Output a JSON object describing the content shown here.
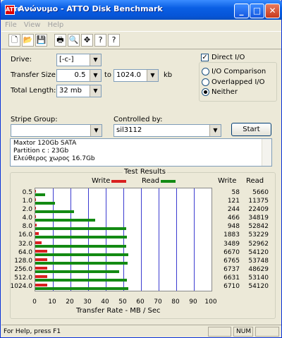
{
  "window": {
    "title": "Ανώνυμο - ATTO Disk Benchmark",
    "app_icon": "ATTO",
    "min": "_",
    "max": "□",
    "close": "✕"
  },
  "menu": [
    "File",
    "View",
    "Help"
  ],
  "toolbar": [
    {
      "icon": "new-icon",
      "glyph": "🗋"
    },
    {
      "icon": "open-icon",
      "glyph": "📂"
    },
    {
      "icon": "save-icon",
      "glyph": "💾"
    },
    {
      "icon": "print-icon",
      "glyph": "🖶"
    },
    {
      "icon": "print-preview-icon",
      "glyph": "🔍"
    },
    {
      "icon": "move-icon",
      "glyph": "✥"
    },
    {
      "icon": "help-icon",
      "glyph": "?"
    },
    {
      "icon": "context-help-icon",
      "glyph": "?"
    }
  ],
  "form": {
    "drive_label": "Drive:",
    "drive_value": "[-c-]",
    "transfer_label": "Transfer Size:",
    "transfer_from": "0.5",
    "to_label": "to",
    "transfer_to": "1024.0",
    "kb_label": "kb",
    "total_label": "Total Length:",
    "total_value": "32 mb",
    "direct_io": "Direct I/O",
    "direct_checked": "✓",
    "io_comparison": "I/O Comparison",
    "overlapped": "Overlapped I/O",
    "neither": "Neither",
    "stripe_label": "Stripe Group:",
    "stripe_value": "",
    "controlled_label": "Controlled by:",
    "controlled_value": "sil3112",
    "start": "Start"
  },
  "info": [
    "Maxtor 120Gb SATA",
    "Partition c : 23Gb",
    "Ελεύθερος χωρος 16.7Gb"
  ],
  "results": {
    "title": "Test Results",
    "write_legend": "Write",
    "read_legend": "Read",
    "write_header": "Write",
    "read_header": "Read",
    "xaxis_label": "Transfer Rate - MB / Sec",
    "colors": {
      "write": "#d92020",
      "read": "#138a13"
    }
  },
  "chart_data": {
    "type": "bar",
    "title": "Test Results",
    "xlabel": "Transfer Rate - MB / Sec",
    "xlim": [
      0,
      100
    ],
    "xticks": [
      "0",
      "10",
      "20",
      "30",
      "40",
      "50",
      "60",
      "70",
      "80",
      "90",
      "100"
    ],
    "categories": [
      "0.5",
      "1.0",
      "2.0",
      "4.0",
      "8.0",
      "16.0",
      "32.0",
      "64.0",
      "128.0",
      "256.0",
      "512.0",
      "1024.0"
    ],
    "series": [
      {
        "name": "Write",
        "values": [
          0.06,
          0.12,
          0.24,
          0.47,
          0.95,
          1.9,
          3.5,
          6.7,
          6.8,
          6.7,
          6.6,
          6.7
        ],
        "labels": [
          "58",
          "121",
          "244",
          "466",
          "948",
          "1883",
          "3489",
          "6670",
          "6765",
          "6737",
          "6631",
          "6710"
        ]
      },
      {
        "name": "Read",
        "values": [
          5.5,
          11.1,
          21.9,
          34.0,
          51.6,
          52.0,
          51.7,
          52.9,
          52.5,
          47.5,
          51.9,
          52.9
        ],
        "labels": [
          "5660",
          "11375",
          "22409",
          "34819",
          "52842",
          "53229",
          "52962",
          "54120",
          "53748",
          "48629",
          "53140",
          "54120"
        ]
      }
    ]
  },
  "status": {
    "help": "For Help, press F1",
    "num": "NUM"
  }
}
